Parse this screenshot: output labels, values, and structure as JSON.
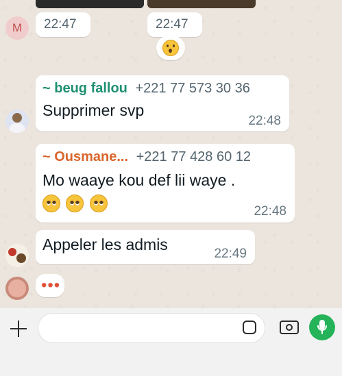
{
  "messages": {
    "top_time_left": "22:47",
    "top_time_right": "22:47",
    "m1": {
      "sender": "~ beug fallou",
      "phone": "+221 77 573 30 36",
      "text": "Supprimer svp",
      "time": "22:48"
    },
    "m2": {
      "sender": "~ Ousmane...",
      "phone": "+221 77 428 60 12",
      "text": "Mo waaye kou def lii waye .",
      "emoji_count": 3,
      "time": "22:48"
    },
    "m3": {
      "text": "Appeler les admis",
      "time": "22:49"
    },
    "typing": "•••"
  },
  "avatar_m": {
    "letter": "M",
    "color": "#d9a3a3"
  },
  "icons": {
    "plus": "plus-icon",
    "sticker": "sticker-icon",
    "camera": "camera-icon",
    "mic": "microphone-icon"
  },
  "colors": {
    "mic_button": "#25b35a",
    "sender_1": "#1f8f73",
    "sender_2": "#d9652b"
  }
}
